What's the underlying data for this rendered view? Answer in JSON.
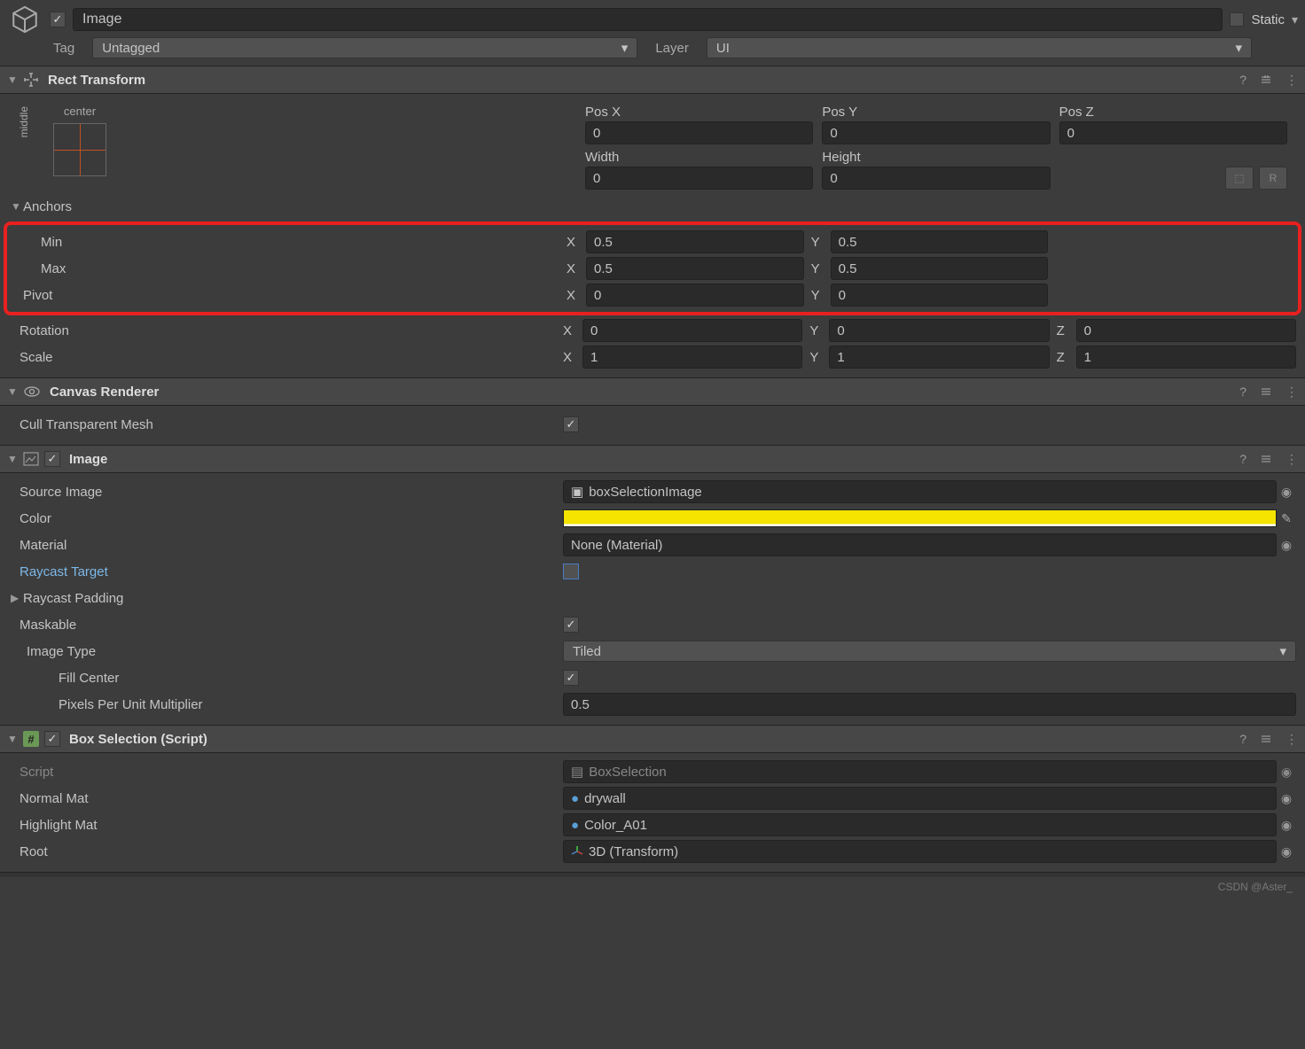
{
  "header": {
    "name": "Image",
    "static_label": "Static",
    "tag_label": "Tag",
    "tag_value": "Untagged",
    "layer_label": "Layer",
    "layer_value": "UI"
  },
  "rect": {
    "title": "Rect Transform",
    "anchor_h": "center",
    "anchor_v": "middle",
    "posx_label": "Pos X",
    "posx": "0",
    "posy_label": "Pos Y",
    "posy": "0",
    "posz_label": "Pos Z",
    "posz": "0",
    "width_label": "Width",
    "width": "0",
    "height_label": "Height",
    "height": "0",
    "anchors_label": "Anchors",
    "min_label": "Min",
    "min_x": "0.5",
    "min_y": "0.5",
    "max_label": "Max",
    "max_x": "0.5",
    "max_y": "0.5",
    "pivot_label": "Pivot",
    "pivot_x": "0",
    "pivot_y": "0",
    "rotation_label": "Rotation",
    "rot_x": "0",
    "rot_y": "0",
    "rot_z": "0",
    "scale_label": "Scale",
    "scale_x": "1",
    "scale_y": "1",
    "scale_z": "1",
    "x": "X",
    "y": "Y",
    "z": "Z",
    "blueprint": "R"
  },
  "canvas": {
    "title": "Canvas Renderer",
    "cull_label": "Cull Transparent Mesh"
  },
  "image": {
    "title": "Image",
    "source_label": "Source Image",
    "source_value": "boxSelectionImage",
    "color_label": "Color",
    "material_label": "Material",
    "material_value": "None (Material)",
    "raycast_target_label": "Raycast Target",
    "raycast_padding_label": "Raycast Padding",
    "maskable_label": "Maskable",
    "image_type_label": "Image Type",
    "image_type_value": "Tiled",
    "fill_center_label": "Fill Center",
    "ppu_label": "Pixels Per Unit Multiplier",
    "ppu_value": "0.5"
  },
  "box": {
    "title": "Box Selection (Script)",
    "script_label": "Script",
    "script_value": "BoxSelection",
    "normal_label": "Normal Mat",
    "normal_value": "drywall",
    "highlight_label": "Highlight Mat",
    "highlight_value": "Color_A01",
    "root_label": "Root",
    "root_value": "3D (Transform)"
  },
  "watermark": "CSDN @Aster_"
}
